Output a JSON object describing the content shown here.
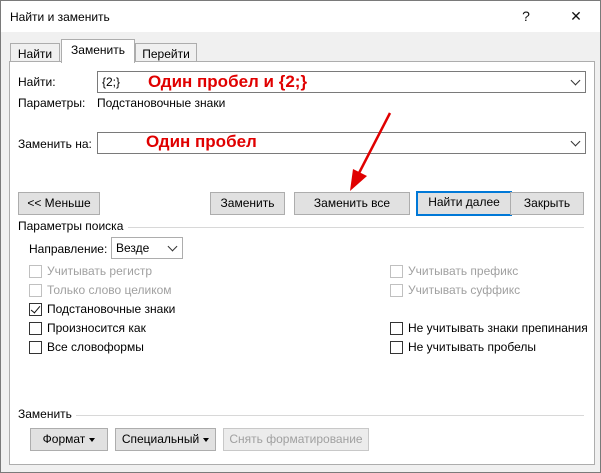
{
  "window": {
    "title": "Найти и заменить",
    "help_glyph": "?",
    "close_glyph": "✕"
  },
  "tabs": [
    {
      "label": "Найти",
      "active": false
    },
    {
      "label": "Заменить",
      "active": true
    },
    {
      "label": "Перейти",
      "active": false
    }
  ],
  "find": {
    "label": "Найти:",
    "value": "{2;}",
    "options_label": "Параметры:",
    "options_value": "Подстановочные знаки"
  },
  "replace": {
    "label": "Заменить на:",
    "value": ""
  },
  "annotations": {
    "find_note": "Один пробел и {2;}",
    "replace_note": "Один пробел"
  },
  "buttons": {
    "less": "<< Меньше",
    "replace": "Заменить",
    "replace_all": "Заменить все",
    "find_next": "Найти далее",
    "close": "Закрыть"
  },
  "search_options": {
    "heading": "Параметры поиска",
    "direction_label": "Направление:",
    "direction_value": "Везде",
    "left": [
      {
        "label": "Учитывать регистр",
        "checked": false,
        "enabled": false
      },
      {
        "label": "Только слово целиком",
        "checked": false,
        "enabled": false
      },
      {
        "label": "Подстановочные знаки",
        "checked": true,
        "enabled": true
      },
      {
        "label": "Произносится как",
        "checked": false,
        "enabled": true
      },
      {
        "label": "Все словоформы",
        "checked": false,
        "enabled": true
      }
    ],
    "right": [
      {
        "label": "Учитывать префикс",
        "checked": false,
        "enabled": false
      },
      {
        "label": "Учитывать суффикс",
        "checked": false,
        "enabled": false
      },
      {
        "label": "Не учитывать знаки препинания",
        "checked": false,
        "enabled": true
      },
      {
        "label": "Не учитывать пробелы",
        "checked": false,
        "enabled": true
      }
    ]
  },
  "replace_section": {
    "heading": "Заменить",
    "format": "Формат",
    "special": "Специальный",
    "clear_formatting": "Снять форматирование"
  },
  "colors": {
    "accent": "#0078d7",
    "annotation": "#e00000"
  }
}
